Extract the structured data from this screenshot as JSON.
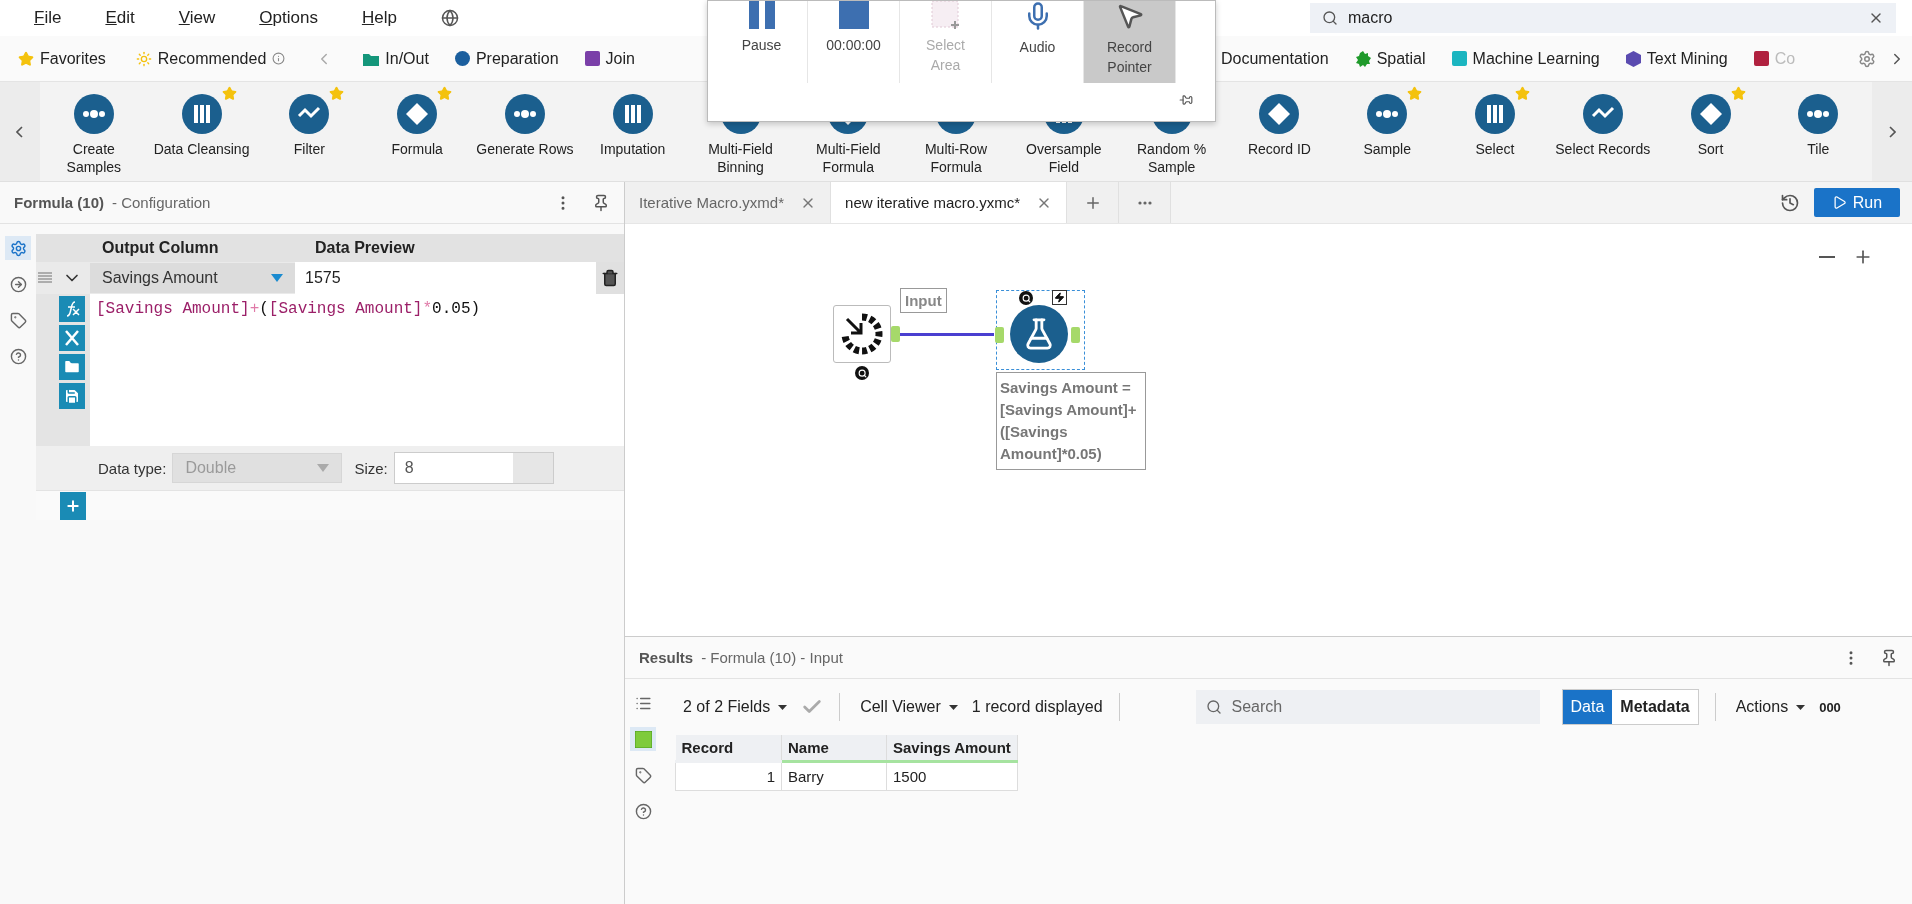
{
  "menu": [
    "File",
    "Edit",
    "View",
    "Options",
    "Help"
  ],
  "search": {
    "value": "macro"
  },
  "category_bar": {
    "shortcuts": [
      {
        "kind": "favorites",
        "label": "Favorites"
      },
      {
        "kind": "recommended",
        "label": "Recommended"
      }
    ],
    "categories_before": [
      {
        "label": "In/Out",
        "color": "#14967a",
        "kind": "folder"
      },
      {
        "label": "Preparation",
        "color": "#1b5f9e",
        "kind": "circle"
      },
      {
        "label": "Join",
        "color": "#7a3fa8",
        "kind": "square"
      }
    ],
    "categories_after": [
      {
        "label": "Documentation",
        "kind": "plain"
      },
      {
        "label": "Spatial",
        "color": "#1f9a2b",
        "kind": "burst"
      },
      {
        "label": "Machine Learning",
        "color": "#1bb5c0",
        "kind": "square"
      },
      {
        "label": "Text Mining",
        "color": "#5a4bb0",
        "kind": "hexagon"
      },
      {
        "label": "Co",
        "color": "#b0213f",
        "kind": "square",
        "faded": true
      }
    ]
  },
  "palette": [
    {
      "label": "Create Samples",
      "favorite": false
    },
    {
      "label": "Data Cleansing",
      "favorite": true
    },
    {
      "label": "Filter",
      "favorite": true
    },
    {
      "label": "Formula",
      "favorite": true
    },
    {
      "label": "Generate Rows",
      "favorite": false
    },
    {
      "label": "Imputation",
      "favorite": false
    },
    {
      "label": "Multi-Field Binning",
      "favorite": false
    },
    {
      "label": "Multi-Field Formula",
      "favorite": false
    },
    {
      "label": "Multi-Row Formula",
      "favorite": false
    },
    {
      "label": "Oversample Field",
      "favorite": false
    },
    {
      "label": "Random % Sample",
      "favorite": false
    },
    {
      "label": "Record ID",
      "favorite": false
    },
    {
      "label": "Sample",
      "favorite": true
    },
    {
      "label": "Select",
      "favorite": true
    },
    {
      "label": "Select Records",
      "favorite": false
    },
    {
      "label": "Sort",
      "favorite": true
    },
    {
      "label": "Tile",
      "favorite": false
    }
  ],
  "recorder": {
    "items": [
      {
        "kind": "pause",
        "label": "Pause",
        "selected": false,
        "disabled": false
      },
      {
        "kind": "stop",
        "label": "00:00:00",
        "selected": false,
        "disabled": false
      },
      {
        "kind": "area",
        "label": "Select Area",
        "selected": false,
        "disabled": true
      },
      {
        "kind": "mic",
        "label": "Audio",
        "selected": false,
        "disabled": false
      },
      {
        "kind": "pointer",
        "label": "Record Pointer",
        "selected": true,
        "disabled": false
      }
    ]
  },
  "config": {
    "title": "Formula (10)",
    "subtitle": "- Configuration",
    "rail": [
      {
        "kind": "settings",
        "selected": true
      },
      {
        "kind": "connection",
        "selected": false
      },
      {
        "kind": "tag",
        "selected": false
      },
      {
        "kind": "help",
        "selected": false
      }
    ],
    "headers": [
      "Output Column",
      "Data Preview"
    ],
    "column": {
      "value": "Savings Amount"
    },
    "preview": "1575",
    "expression": [
      {
        "kind": "field",
        "text": "[Savings Amount]"
      },
      {
        "kind": "operator",
        "text": "+"
      },
      {
        "kind": "plain",
        "text": "("
      },
      {
        "kind": "field",
        "text": "[Savings Amount]"
      },
      {
        "kind": "operator",
        "text": "*"
      },
      {
        "kind": "plain",
        "text": "0.05)"
      }
    ],
    "data_type": {
      "label": "Data type:",
      "value": "Double",
      "disabled": true
    },
    "size": {
      "label": "Size:",
      "value": "8"
    }
  },
  "tabs": [
    {
      "label": "Iterative Macro.yxmd*",
      "selected": false
    },
    {
      "label": "new iterative macro.yxmc*",
      "selected": true
    }
  ],
  "run_button": "Run",
  "canvas": {
    "input_node": {
      "label": "Input"
    },
    "formula_node": {
      "selected": true,
      "annotation": "Savings Amount = [Savings Amount]+ ([Savings Amount]*0.05)"
    }
  },
  "results": {
    "title": "Results",
    "subtitle": "- Formula (10) - Input",
    "rail": [
      {
        "kind": "list",
        "selected": false
      },
      {
        "kind": "table",
        "selected": true
      },
      {
        "kind": "tag",
        "selected": false
      },
      {
        "kind": "help",
        "selected": false
      }
    ],
    "fields": "2 of 2 Fields",
    "viewer": "Cell Viewer",
    "count": "1 record displayed",
    "search": {
      "placeholder": "Search"
    },
    "views": [
      {
        "label": "Data",
        "selected": true
      },
      {
        "label": "Metadata",
        "selected": false
      }
    ],
    "actions": "Actions",
    "extra": "000",
    "columns": [
      "Record",
      "Name",
      "Savings Amount"
    ],
    "rows": [
      [
        "1",
        "Barry",
        "1500"
      ]
    ]
  }
}
